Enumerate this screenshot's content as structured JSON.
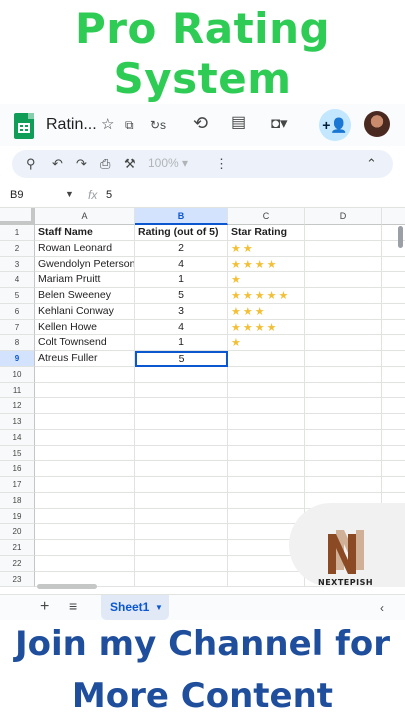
{
  "promo": {
    "title_line1": "Pro Rating",
    "title_line2": "System",
    "cta_line1": "Join my Channel for",
    "cta_line2": "More Content",
    "brand": "NEXTEPISH"
  },
  "app": {
    "doc_title": "Ratin...",
    "icons": [
      "sheets-logo",
      "star-icon",
      "move-to-folder-icon",
      "sync-icon",
      "history-icon",
      "comment-icon",
      "meet-icon",
      "share-icon",
      "avatar"
    ]
  },
  "toolbar": {
    "zoom": "100%"
  },
  "formula_bar": {
    "cell_ref": "B9",
    "fx": "fx",
    "value": "5"
  },
  "sheet": {
    "columns": [
      "A",
      "B",
      "C",
      "D"
    ],
    "active_column": "B",
    "row_count": 23,
    "active_row": 9,
    "headers": [
      "Staff Name",
      "Rating (out of 5)",
      "Star Rating"
    ],
    "rows": [
      {
        "name": "Rowan Leonard",
        "rating": "2",
        "stars": "★★"
      },
      {
        "name": "Gwendolyn Peterson",
        "rating": "4",
        "stars": "★★★★"
      },
      {
        "name": "Mariam Pruitt",
        "rating": "1",
        "stars": "★"
      },
      {
        "name": "Belen Sweeney",
        "rating": "5",
        "stars": "★★★★★"
      },
      {
        "name": "Kehlani Conway",
        "rating": "3",
        "stars": "★★★"
      },
      {
        "name": "Kellen Howe",
        "rating": "4",
        "stars": "★★★★"
      },
      {
        "name": "Colt Townsend",
        "rating": "1",
        "stars": "★"
      },
      {
        "name": "Atreus Fuller",
        "rating": "5",
        "stars": ""
      }
    ],
    "star_color": "#f2c037"
  },
  "bottom": {
    "add_label": "+",
    "all_sheets_label": "≡",
    "sheet_tab": "Sheet1"
  },
  "colors": {
    "title_green": "#2ecc55",
    "cta_blue": "#1f4e9c",
    "selection_blue": "#0b57d0"
  }
}
